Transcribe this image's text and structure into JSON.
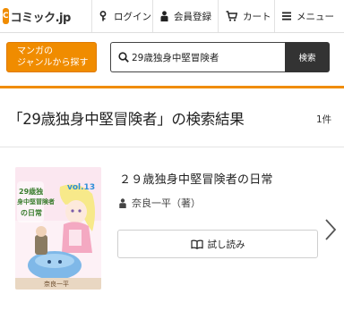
{
  "header": {
    "logo_mark": "C",
    "logo_text": "コミック.jp",
    "nav": {
      "login": "ログイン",
      "register": "会員登録",
      "cart": "カート",
      "menu": "メニュー"
    }
  },
  "search": {
    "genre_button_line1": "マンガの",
    "genre_button_line2": "ジャンルから探す",
    "query": "29歳独身中堅冒険者",
    "button_label": "検索"
  },
  "results": {
    "title": "「29歳独身中堅冒険者」の検索結果",
    "count": "1件"
  },
  "items": [
    {
      "title": "２９歳独身中堅冒険者の日常",
      "author": "奈良一平（著）",
      "trial_label": "試し読み",
      "cover": {
        "volume": "vol.13",
        "title_line1": "29歳独",
        "title_line2": "身中堅冒険者",
        "title_line3": "の日常",
        "author": "奈良一平"
      }
    }
  ],
  "colors": {
    "accent": "#f08c00",
    "search_button": "#333333"
  },
  "icons": {
    "login": "key-icon",
    "register": "person-icon",
    "cart": "cart-icon",
    "menu": "menu-icon",
    "search": "search-icon",
    "author": "person-icon",
    "trial": "open-book-icon",
    "next": "chevron-right-icon"
  }
}
